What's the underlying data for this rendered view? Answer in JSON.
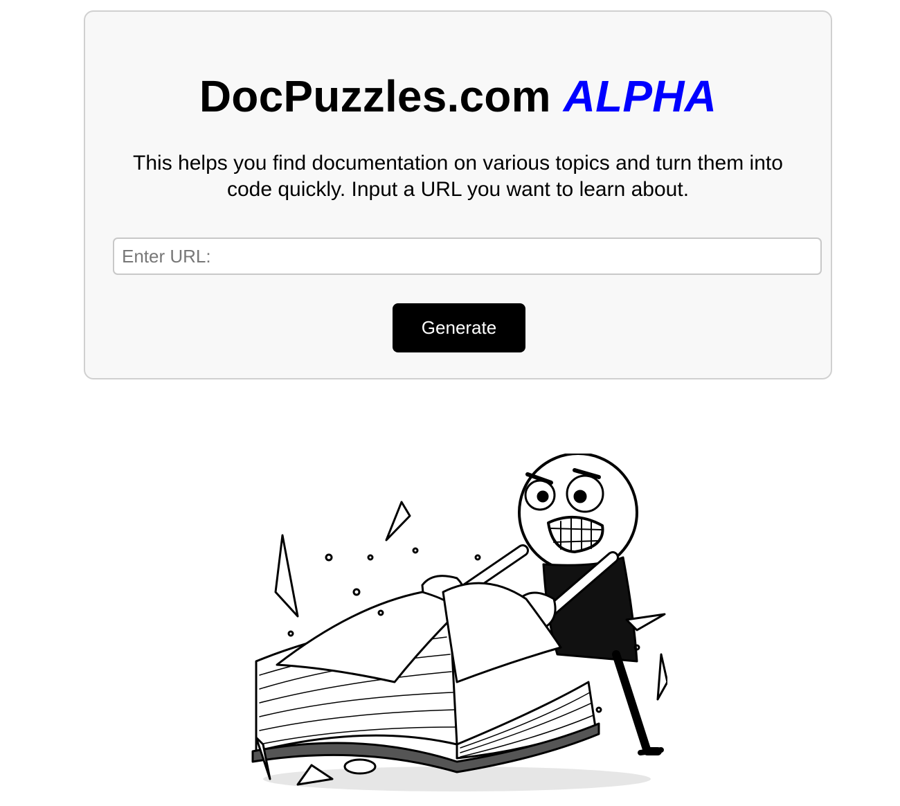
{
  "header": {
    "title_main": "DocPuzzles.com",
    "title_accent": "ALPHA",
    "accent_color": "#0000ff"
  },
  "intro": {
    "description": "This helps you find documentation on various topics and turn them into code quickly. Input a URL you want to learn about."
  },
  "form": {
    "url_placeholder": "Enter URL:",
    "url_value": "",
    "generate_label": "Generate"
  },
  "illustration": {
    "icon": "angry-stick-figure-tearing-book-illustration"
  }
}
